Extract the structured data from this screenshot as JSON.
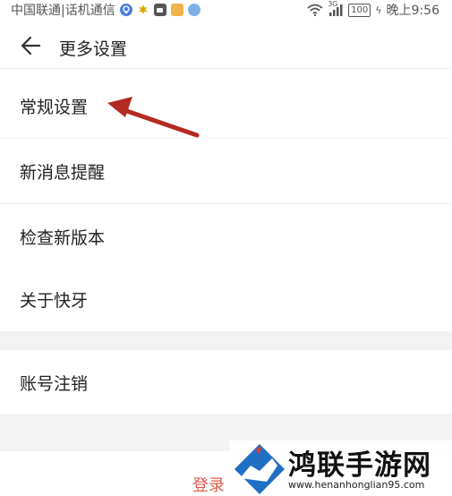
{
  "status_bar": {
    "carrier": "中国联通|话机通信",
    "battery": "100",
    "time": "晚上9:56",
    "network": "3G"
  },
  "header": {
    "title": "更多设置"
  },
  "menu": [
    {
      "label": "常规设置"
    },
    {
      "label": "新消息提醒"
    },
    {
      "label": "检查新版本"
    },
    {
      "label": "关于快牙"
    },
    {
      "label": "账号注销"
    }
  ],
  "login_label": "登录",
  "watermark": {
    "title": "鸿联手游网",
    "url": "www.henanhonglian95.com"
  },
  "colors": {
    "annotation_arrow": "#b52a22",
    "login_text": "#e05a4e",
    "gap_background": "#f3f3f3"
  }
}
